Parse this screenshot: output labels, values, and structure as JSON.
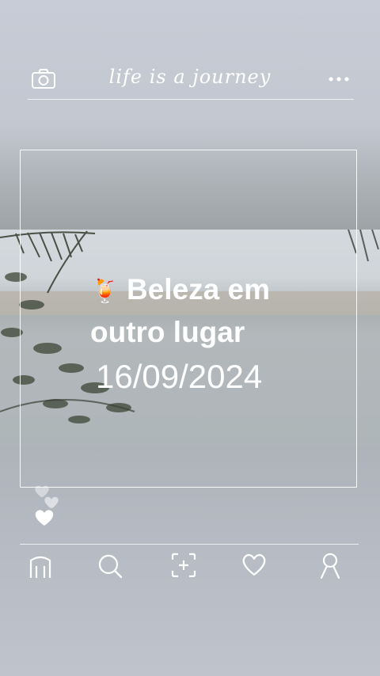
{
  "header": {
    "title": "life is a journey",
    "left_icon": "camera-icon",
    "right_icon": "more-icon"
  },
  "post": {
    "emoji": "🍹",
    "headline_line1": "Beleza em",
    "headline_line2": "outro lugar",
    "date": "16/09/2024"
  },
  "bottom_nav": {
    "items": [
      "home-icon",
      "search-icon",
      "scan-add-icon",
      "heart-icon",
      "profile-icon"
    ]
  },
  "colors": {
    "overlay_text": "#ffffff",
    "lines": "#ffffff"
  }
}
